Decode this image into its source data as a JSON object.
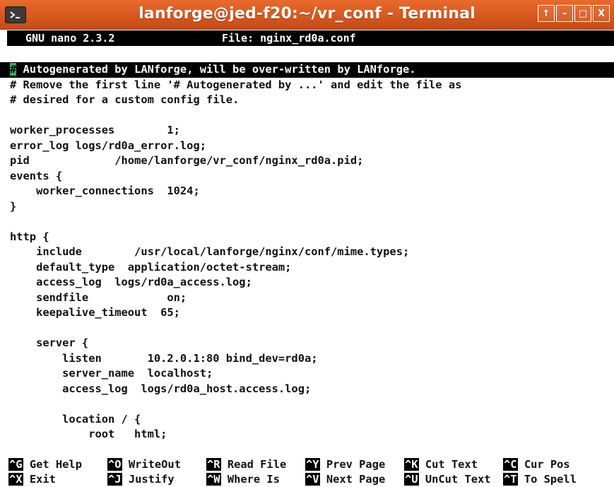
{
  "window": {
    "title": "lanforge@jed-f20:~/vr_conf - Terminal",
    "buttons": [
      "↑",
      "–",
      "□",
      "X"
    ],
    "title_bar_color": "#d85a1e"
  },
  "nano": {
    "version": "GNU nano 2.3.2",
    "file_label": "File: nginx_rd0a.conf"
  },
  "editor": {
    "cursor_char": "#",
    "first_line_rest": " Autogenerated by LANforge, will be over-written by LANforge.",
    "lines": [
      "# Remove the first line '# Autogenerated by ...' and edit the file as",
      "# desired for a custom config file.",
      "",
      "worker_processes        1;",
      "error_log logs/rd0a_error.log;",
      "pid             /home/lanforge/vr_conf/nginx_rd0a.pid;",
      "events {",
      "    worker_connections  1024;",
      "}",
      "",
      "http {",
      "    include        /usr/local/lanforge/nginx/conf/mime.types;",
      "    default_type  application/octet-stream;",
      "    access_log  logs/rd0a_access.log;",
      "    sendfile            on;",
      "    keepalive_timeout  65;",
      "",
      "    server {",
      "        listen       10.2.0.1:80 bind_dev=rd0a;",
      "        server_name  localhost;",
      "        access_log  logs/rd0a_host.access.log;",
      "",
      "        location / {",
      "            root   html;"
    ]
  },
  "shortcuts": [
    {
      "key": "^G",
      "label": "Get Help"
    },
    {
      "key": "^O",
      "label": "WriteOut"
    },
    {
      "key": "^R",
      "label": "Read File"
    },
    {
      "key": "^Y",
      "label": "Prev Page"
    },
    {
      "key": "^K",
      "label": "Cut Text"
    },
    {
      "key": "^C",
      "label": "Cur Pos"
    },
    {
      "key": "^X",
      "label": "Exit"
    },
    {
      "key": "^J",
      "label": "Justify"
    },
    {
      "key": "^W",
      "label": "Where Is"
    },
    {
      "key": "^V",
      "label": "Next Page"
    },
    {
      "key": "^U",
      "label": "UnCut Text"
    },
    {
      "key": "^T",
      "label": "To Spell"
    }
  ],
  "colors": {
    "cursor": "#2fb35a",
    "highlight_bg": "#000000",
    "text": "#111111"
  }
}
